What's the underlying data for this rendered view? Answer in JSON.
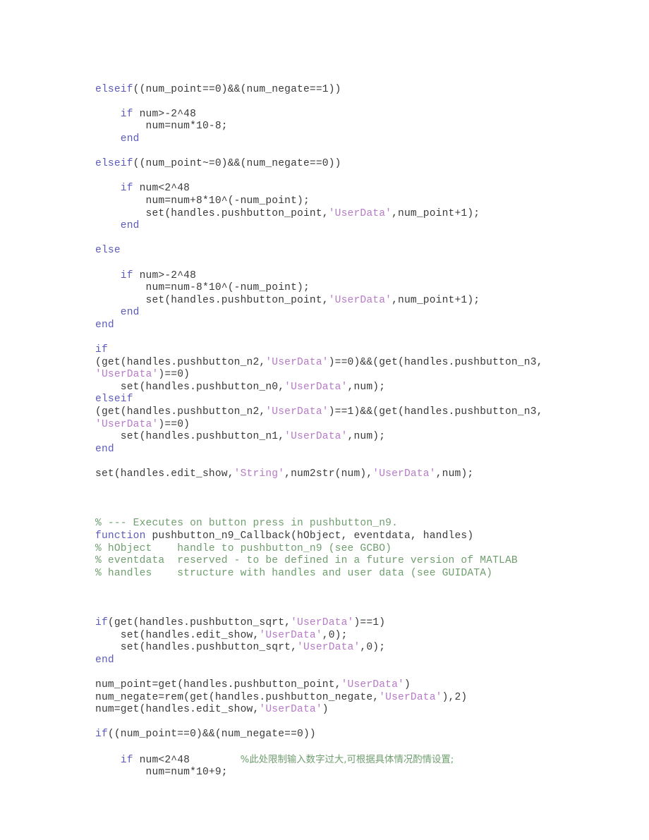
{
  "document": {
    "kind": "source-code-listing",
    "language": "MATLAB",
    "page_background": "#ffffff",
    "colors": {
      "plain": "#3a3a3a",
      "keyword": "#5b5bbd",
      "string": "#b77bc8",
      "comment": "#6f9e6f"
    }
  },
  "code": {
    "lines": [
      {
        "id": "l1",
        "tokens": [
          {
            "t": "keyword",
            "v": "elseif"
          },
          {
            "t": "plain",
            "v": "((num_point==0)&&(num_negate==1))"
          }
        ]
      },
      {
        "id": "l2",
        "tokens": []
      },
      {
        "id": "l3",
        "tokens": [
          {
            "t": "plain",
            "v": "    "
          },
          {
            "t": "keyword",
            "v": "if"
          },
          {
            "t": "plain",
            "v": " num>-2^48"
          }
        ]
      },
      {
        "id": "l4",
        "tokens": [
          {
            "t": "plain",
            "v": "        num=num*10-8;"
          }
        ]
      },
      {
        "id": "l5",
        "tokens": [
          {
            "t": "plain",
            "v": "    "
          },
          {
            "t": "keyword",
            "v": "end"
          }
        ]
      },
      {
        "id": "l6",
        "tokens": []
      },
      {
        "id": "l7",
        "tokens": [
          {
            "t": "keyword",
            "v": "elseif"
          },
          {
            "t": "plain",
            "v": "((num_point~=0)&&(num_negate==0))"
          }
        ]
      },
      {
        "id": "l8",
        "tokens": []
      },
      {
        "id": "l9",
        "tokens": [
          {
            "t": "plain",
            "v": "    "
          },
          {
            "t": "keyword",
            "v": "if"
          },
          {
            "t": "plain",
            "v": " num<2^48"
          }
        ]
      },
      {
        "id": "l10",
        "tokens": [
          {
            "t": "plain",
            "v": "        num=num+8*10^(-num_point);"
          }
        ]
      },
      {
        "id": "l11",
        "tokens": [
          {
            "t": "plain",
            "v": "        set(handles.pushbutton_point,"
          },
          {
            "t": "string",
            "v": "'UserData'"
          },
          {
            "t": "plain",
            "v": ",num_point+1);"
          }
        ]
      },
      {
        "id": "l12",
        "tokens": [
          {
            "t": "plain",
            "v": "    "
          },
          {
            "t": "keyword",
            "v": "end"
          }
        ]
      },
      {
        "id": "l13",
        "tokens": []
      },
      {
        "id": "l14",
        "tokens": [
          {
            "t": "keyword",
            "v": "else"
          }
        ]
      },
      {
        "id": "l15",
        "tokens": []
      },
      {
        "id": "l16",
        "tokens": [
          {
            "t": "plain",
            "v": "    "
          },
          {
            "t": "keyword",
            "v": "if"
          },
          {
            "t": "plain",
            "v": " num>-2^48"
          }
        ]
      },
      {
        "id": "l17",
        "tokens": [
          {
            "t": "plain",
            "v": "        num=num-8*10^(-num_point);"
          }
        ]
      },
      {
        "id": "l18",
        "tokens": [
          {
            "t": "plain",
            "v": "        set(handles.pushbutton_point,"
          },
          {
            "t": "string",
            "v": "'UserData'"
          },
          {
            "t": "plain",
            "v": ",num_point+1);"
          }
        ]
      },
      {
        "id": "l19",
        "tokens": [
          {
            "t": "plain",
            "v": "    "
          },
          {
            "t": "keyword",
            "v": "end"
          }
        ]
      },
      {
        "id": "l20",
        "tokens": [
          {
            "t": "keyword",
            "v": "end"
          }
        ]
      },
      {
        "id": "l21",
        "tokens": []
      },
      {
        "id": "l22",
        "tokens": [
          {
            "t": "keyword",
            "v": "if"
          }
        ]
      },
      {
        "id": "l23",
        "tokens": [
          {
            "t": "plain",
            "v": "(get(handles.pushbutton_n2,"
          },
          {
            "t": "string",
            "v": "'UserData'"
          },
          {
            "t": "plain",
            "v": ")==0)&&(get(handles.pushbutton_n3,"
          }
        ]
      },
      {
        "id": "l24",
        "tokens": [
          {
            "t": "string",
            "v": "'UserData'"
          },
          {
            "t": "plain",
            "v": ")==0)"
          }
        ]
      },
      {
        "id": "l25",
        "tokens": [
          {
            "t": "plain",
            "v": "    set(handles.pushbutton_n0,"
          },
          {
            "t": "string",
            "v": "'UserData'"
          },
          {
            "t": "plain",
            "v": ",num);"
          }
        ]
      },
      {
        "id": "l26",
        "tokens": [
          {
            "t": "keyword",
            "v": "elseif"
          }
        ]
      },
      {
        "id": "l27",
        "tokens": [
          {
            "t": "plain",
            "v": "(get(handles.pushbutton_n2,"
          },
          {
            "t": "string",
            "v": "'UserData'"
          },
          {
            "t": "plain",
            "v": ")==1)&&(get(handles.pushbutton_n3,"
          }
        ]
      },
      {
        "id": "l28",
        "tokens": [
          {
            "t": "string",
            "v": "'UserData'"
          },
          {
            "t": "plain",
            "v": ")==0)"
          }
        ]
      },
      {
        "id": "l29",
        "tokens": [
          {
            "t": "plain",
            "v": "    set(handles.pushbutton_n1,"
          },
          {
            "t": "string",
            "v": "'UserData'"
          },
          {
            "t": "plain",
            "v": ",num);"
          }
        ]
      },
      {
        "id": "l30",
        "tokens": [
          {
            "t": "keyword",
            "v": "end"
          }
        ]
      },
      {
        "id": "l31",
        "tokens": []
      },
      {
        "id": "l32",
        "tokens": [
          {
            "t": "plain",
            "v": "set(handles.edit_show,"
          },
          {
            "t": "string",
            "v": "'String'"
          },
          {
            "t": "plain",
            "v": ",num2str(num),"
          },
          {
            "t": "string",
            "v": "'UserData'"
          },
          {
            "t": "plain",
            "v": ",num);"
          }
        ]
      },
      {
        "id": "l33",
        "tokens": []
      },
      {
        "id": "l34",
        "tokens": []
      },
      {
        "id": "l35",
        "tokens": []
      },
      {
        "id": "l36",
        "tokens": [
          {
            "t": "comment",
            "v": "% --- Executes on button press in pushbutton_n9."
          }
        ]
      },
      {
        "id": "l37",
        "tokens": [
          {
            "t": "keyword",
            "v": "function"
          },
          {
            "t": "plain",
            "v": " pushbutton_n9_Callback(hObject, eventdata, handles)"
          }
        ]
      },
      {
        "id": "l38",
        "tokens": [
          {
            "t": "comment",
            "v": "% hObject    handle to pushbutton_n9 (see GCBO)"
          }
        ]
      },
      {
        "id": "l39",
        "tokens": [
          {
            "t": "comment",
            "v": "% eventdata  reserved - to be defined in a future version of MATLAB"
          }
        ]
      },
      {
        "id": "l40",
        "tokens": [
          {
            "t": "comment",
            "v": "% handles    structure with handles and user data (see GUIDATA)"
          }
        ]
      },
      {
        "id": "l41",
        "tokens": []
      },
      {
        "id": "l42",
        "tokens": []
      },
      {
        "id": "l43",
        "tokens": []
      },
      {
        "id": "l44",
        "tokens": [
          {
            "t": "keyword",
            "v": "if"
          },
          {
            "t": "plain",
            "v": "(get(handles.pushbutton_sqrt,"
          },
          {
            "t": "string",
            "v": "'UserData'"
          },
          {
            "t": "plain",
            "v": ")==1)"
          }
        ]
      },
      {
        "id": "l45",
        "tokens": [
          {
            "t": "plain",
            "v": "    set(handles.edit_show,"
          },
          {
            "t": "string",
            "v": "'UserData'"
          },
          {
            "t": "plain",
            "v": ",0);"
          }
        ]
      },
      {
        "id": "l46",
        "tokens": [
          {
            "t": "plain",
            "v": "    set(handles.pushbutton_sqrt,"
          },
          {
            "t": "string",
            "v": "'UserData'"
          },
          {
            "t": "plain",
            "v": ",0);"
          }
        ]
      },
      {
        "id": "l47",
        "tokens": [
          {
            "t": "keyword",
            "v": "end"
          }
        ]
      },
      {
        "id": "l48",
        "tokens": []
      },
      {
        "id": "l49",
        "tokens": [
          {
            "t": "plain",
            "v": "num_point=get(handles.pushbutton_point,"
          },
          {
            "t": "string",
            "v": "'UserData'"
          },
          {
            "t": "plain",
            "v": ")"
          }
        ]
      },
      {
        "id": "l50",
        "tokens": [
          {
            "t": "plain",
            "v": "num_negate=rem(get(handles.pushbutton_negate,"
          },
          {
            "t": "string",
            "v": "'UserData'"
          },
          {
            "t": "plain",
            "v": "),2)"
          }
        ]
      },
      {
        "id": "l51",
        "tokens": [
          {
            "t": "plain",
            "v": "num=get(handles.edit_show,"
          },
          {
            "t": "string",
            "v": "'UserData'"
          },
          {
            "t": "plain",
            "v": ")"
          }
        ]
      },
      {
        "id": "l52",
        "tokens": []
      },
      {
        "id": "l53",
        "tokens": [
          {
            "t": "keyword",
            "v": "if"
          },
          {
            "t": "plain",
            "v": "((num_point==0)&&(num_negate==0))"
          }
        ]
      },
      {
        "id": "l54",
        "tokens": []
      },
      {
        "id": "l55",
        "tokens": [
          {
            "t": "plain",
            "v": "    "
          },
          {
            "t": "keyword",
            "v": "if"
          },
          {
            "t": "plain",
            "v": " num<2^48        "
          },
          {
            "t": "cjk",
            "v": "%此处限制输入数字过大,可根据具体情况酌情设置;"
          }
        ]
      },
      {
        "id": "l56",
        "tokens": [
          {
            "t": "plain",
            "v": "        num=num*10+9;"
          }
        ]
      }
    ]
  }
}
